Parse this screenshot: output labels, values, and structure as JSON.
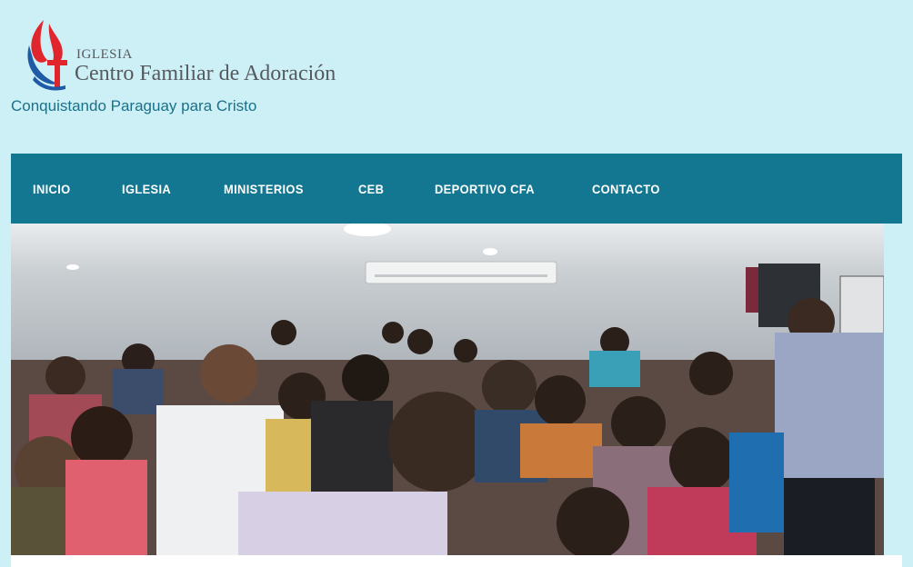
{
  "logo": {
    "small_text": "IGLESIA",
    "big_text": "Centro Familiar de Adoración"
  },
  "tagline": "Conquistando Paraguay para Cristo",
  "nav": {
    "items": [
      {
        "label": "INICIO"
      },
      {
        "label": "IGLESIA"
      },
      {
        "label": "MINISTERIOS"
      },
      {
        "label": "CEB"
      },
      {
        "label": "DEPORTIVO CFA"
      },
      {
        "label": "CONTACTO"
      }
    ]
  },
  "colors": {
    "background": "#cdeff6",
    "nav_background": "#137792",
    "tagline": "#1a7189",
    "logo_red": "#e0262c",
    "logo_blue": "#1f5aa6"
  }
}
